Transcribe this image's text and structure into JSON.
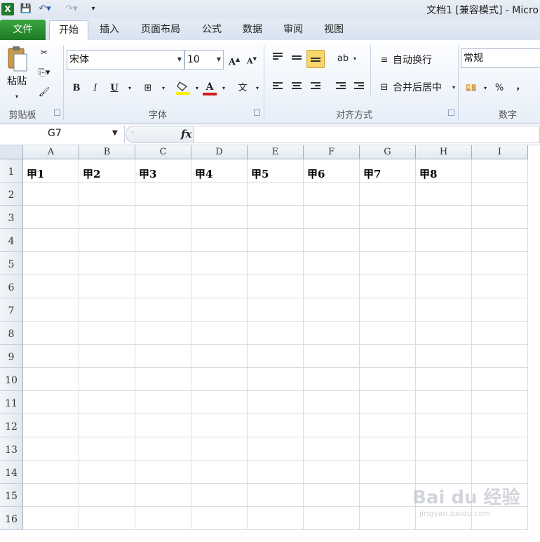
{
  "titlebar": {
    "title": "文档1  [兼容模式] - Micro"
  },
  "tabs": {
    "file": "文件",
    "items": [
      "开始",
      "插入",
      "页面布局",
      "公式",
      "数据",
      "审阅",
      "视图"
    ],
    "active_index": 0
  },
  "ribbon": {
    "clipboard": {
      "paste_label": "粘贴",
      "group_label": "剪贴板"
    },
    "font": {
      "name": "宋体",
      "size": "10",
      "group_label": "字体",
      "bold": "B",
      "italic": "I",
      "underline": "U",
      "grow": "A",
      "shrink": "A",
      "font_color": "A",
      "phonetic": "wén"
    },
    "alignment": {
      "wrap_text": "自动换行",
      "merge_center": "合并后居中",
      "group_label": "对齐方式"
    },
    "number": {
      "format": "常规",
      "group_label": "数字",
      "percent": "%",
      "comma": ","
    }
  },
  "formula_bar": {
    "name_box": "G7",
    "fx": "fx",
    "formula": ""
  },
  "sheet": {
    "columns": [
      "A",
      "B",
      "C",
      "D",
      "E",
      "F",
      "G",
      "H",
      "I"
    ],
    "rows": [
      "1",
      "2",
      "3",
      "4",
      "5",
      "6",
      "7",
      "8",
      "9",
      "10",
      "11",
      "12",
      "13",
      "14",
      "15",
      "16"
    ],
    "row1_values": [
      "甲1",
      "甲2",
      "甲3",
      "甲4",
      "甲5",
      "甲6",
      "甲7",
      "甲8",
      ""
    ]
  },
  "watermark": {
    "brand": "Bai du 经验",
    "url": "jingyan.baidu.com"
  },
  "colors": {
    "file_tab": "#1e7b27",
    "ribbon_bg": "#e7eef8",
    "highlight": "#f5d96b",
    "font_red": "#d11b1b"
  }
}
